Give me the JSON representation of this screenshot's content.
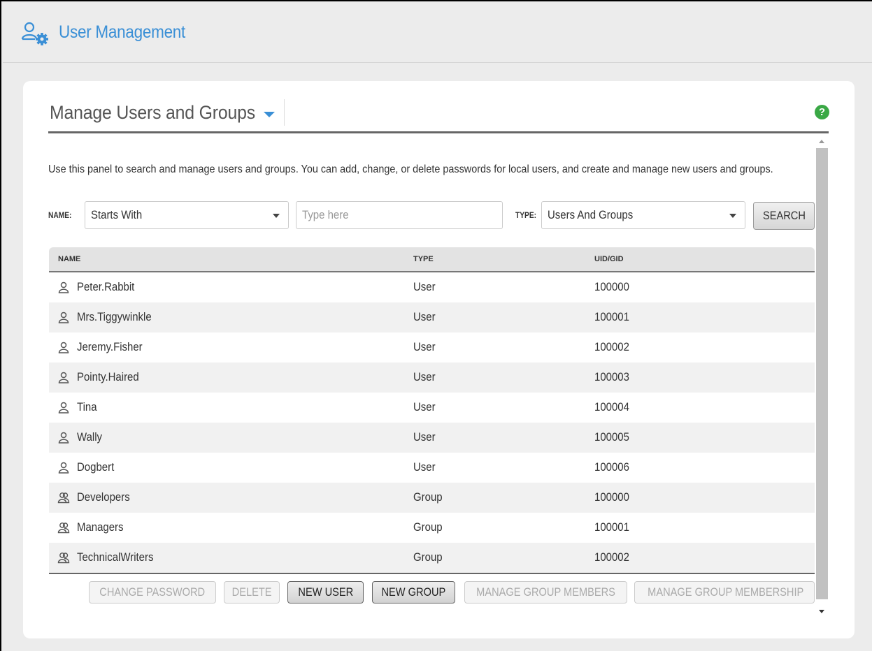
{
  "header": {
    "title": "User Management",
    "accent_color": "#3a8fd6"
  },
  "panel": {
    "title": "Manage Users and Groups",
    "help_label": "?",
    "description": "Use this panel to search and manage users and groups. You can add, change, or delete passwords for local users, and create and manage new users and groups."
  },
  "search": {
    "name_label": "NAME:",
    "name_filter_value": "Starts With",
    "name_placeholder": "Type here",
    "type_label": "TYPE:",
    "type_value": "Users And Groups",
    "search_button": "SEARCH"
  },
  "table": {
    "columns": [
      "NAME",
      "TYPE",
      "UID/GID"
    ],
    "rows": [
      {
        "icon": "user-icon",
        "name": "Peter.Rabbit",
        "type": "User",
        "id": "100000"
      },
      {
        "icon": "user-icon",
        "name": "Mrs.Tiggywinkle",
        "type": "User",
        "id": "100001"
      },
      {
        "icon": "user-icon",
        "name": "Jeremy.Fisher",
        "type": "User",
        "id": "100002"
      },
      {
        "icon": "user-icon",
        "name": "Pointy.Haired",
        "type": "User",
        "id": "100003"
      },
      {
        "icon": "user-icon",
        "name": "Tina",
        "type": "User",
        "id": "100004"
      },
      {
        "icon": "user-icon",
        "name": "Wally",
        "type": "User",
        "id": "100005"
      },
      {
        "icon": "user-icon",
        "name": "Dogbert",
        "type": "User",
        "id": "100006"
      },
      {
        "icon": "group-icon",
        "name": "Developers",
        "type": "Group",
        "id": "100000"
      },
      {
        "icon": "group-icon",
        "name": "Managers",
        "type": "Group",
        "id": "100001"
      },
      {
        "icon": "group-icon",
        "name": "TechnicalWriters",
        "type": "Group",
        "id": "100002"
      }
    ]
  },
  "actions": {
    "change_password": "CHANGE PASSWORD",
    "delete": "DELETE",
    "new_user": "NEW USER",
    "new_group": "NEW GROUP",
    "manage_group_members": "MANAGE GROUP MEMBERS",
    "manage_group_membership": "MANAGE GROUP MEMBERSHIP"
  }
}
